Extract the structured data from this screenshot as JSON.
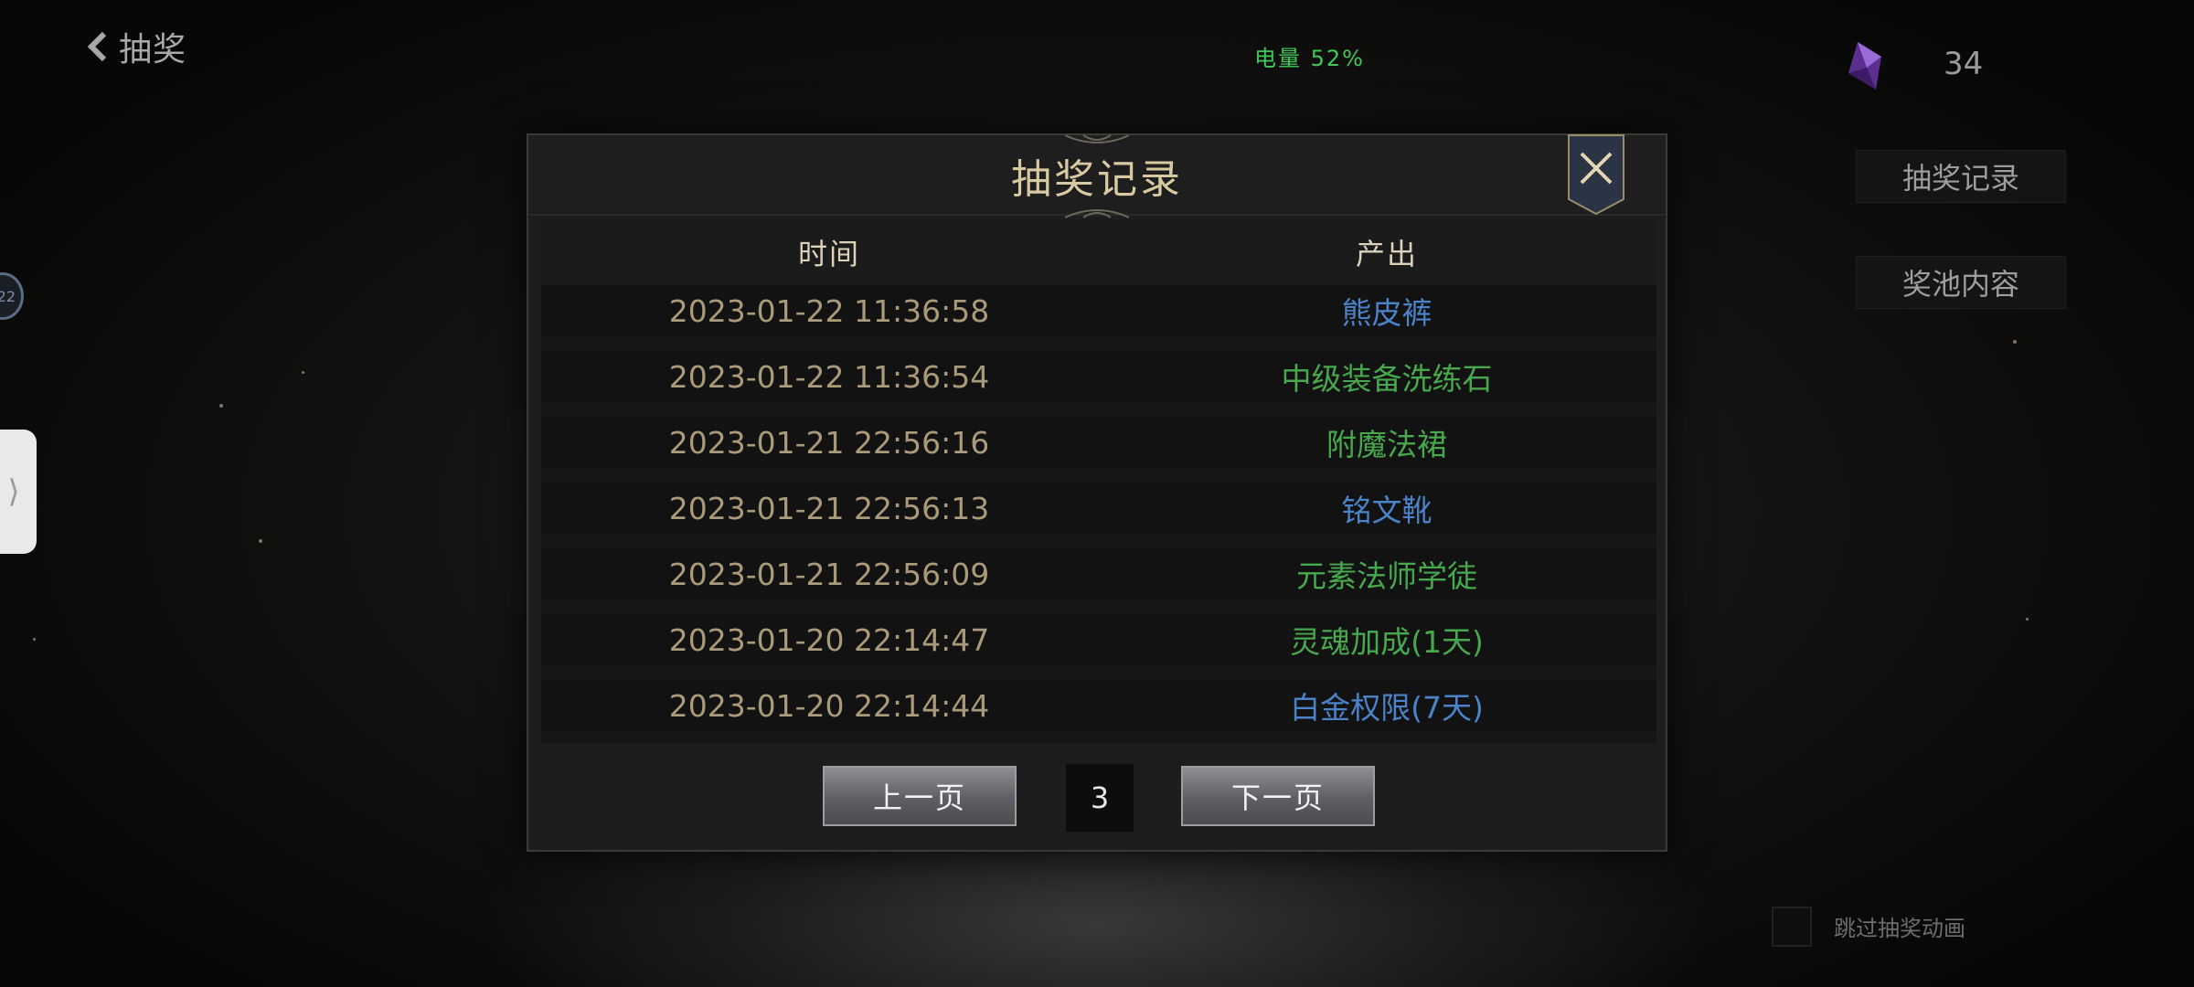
{
  "header": {
    "back_label": "抽奖",
    "battery_text": "电量 52%",
    "gem_count": "34"
  },
  "side_menu": {
    "record_label": "抽奖记录",
    "pool_label": "奖池内容"
  },
  "left_badge": "22",
  "skip_animation_label": "跳过抽奖动画",
  "modal": {
    "title": "抽奖记录",
    "columns": {
      "time": "时间",
      "output": "产出"
    },
    "rows": [
      {
        "time": "2023-01-22 11:36:58",
        "output": "熊皮裤",
        "color": "#4b83c9"
      },
      {
        "time": "2023-01-22 11:36:54",
        "output": "中级装备洗练石",
        "color": "#47a84d"
      },
      {
        "time": "2023-01-21 22:56:16",
        "output": "附魔法裙",
        "color": "#47a84d"
      },
      {
        "time": "2023-01-21 22:56:13",
        "output": "铭文靴",
        "color": "#4b83c9"
      },
      {
        "time": "2023-01-21 22:56:09",
        "output": "元素法师学徒",
        "color": "#47a84d"
      },
      {
        "time": "2023-01-20 22:14:47",
        "output": "灵魂加成(1天)",
        "color": "#47a84d"
      },
      {
        "time": "2023-01-20 22:14:44",
        "output": "白金权限(7天)",
        "color": "#4b83c9"
      }
    ],
    "pager": {
      "prev_label": "上一页",
      "page": "3",
      "next_label": "下一页"
    }
  },
  "colors": {
    "title_gold": "#d9c9a3",
    "item_green": "#47a84d",
    "item_blue": "#4b83c9",
    "battery_green": "#41c85a"
  }
}
